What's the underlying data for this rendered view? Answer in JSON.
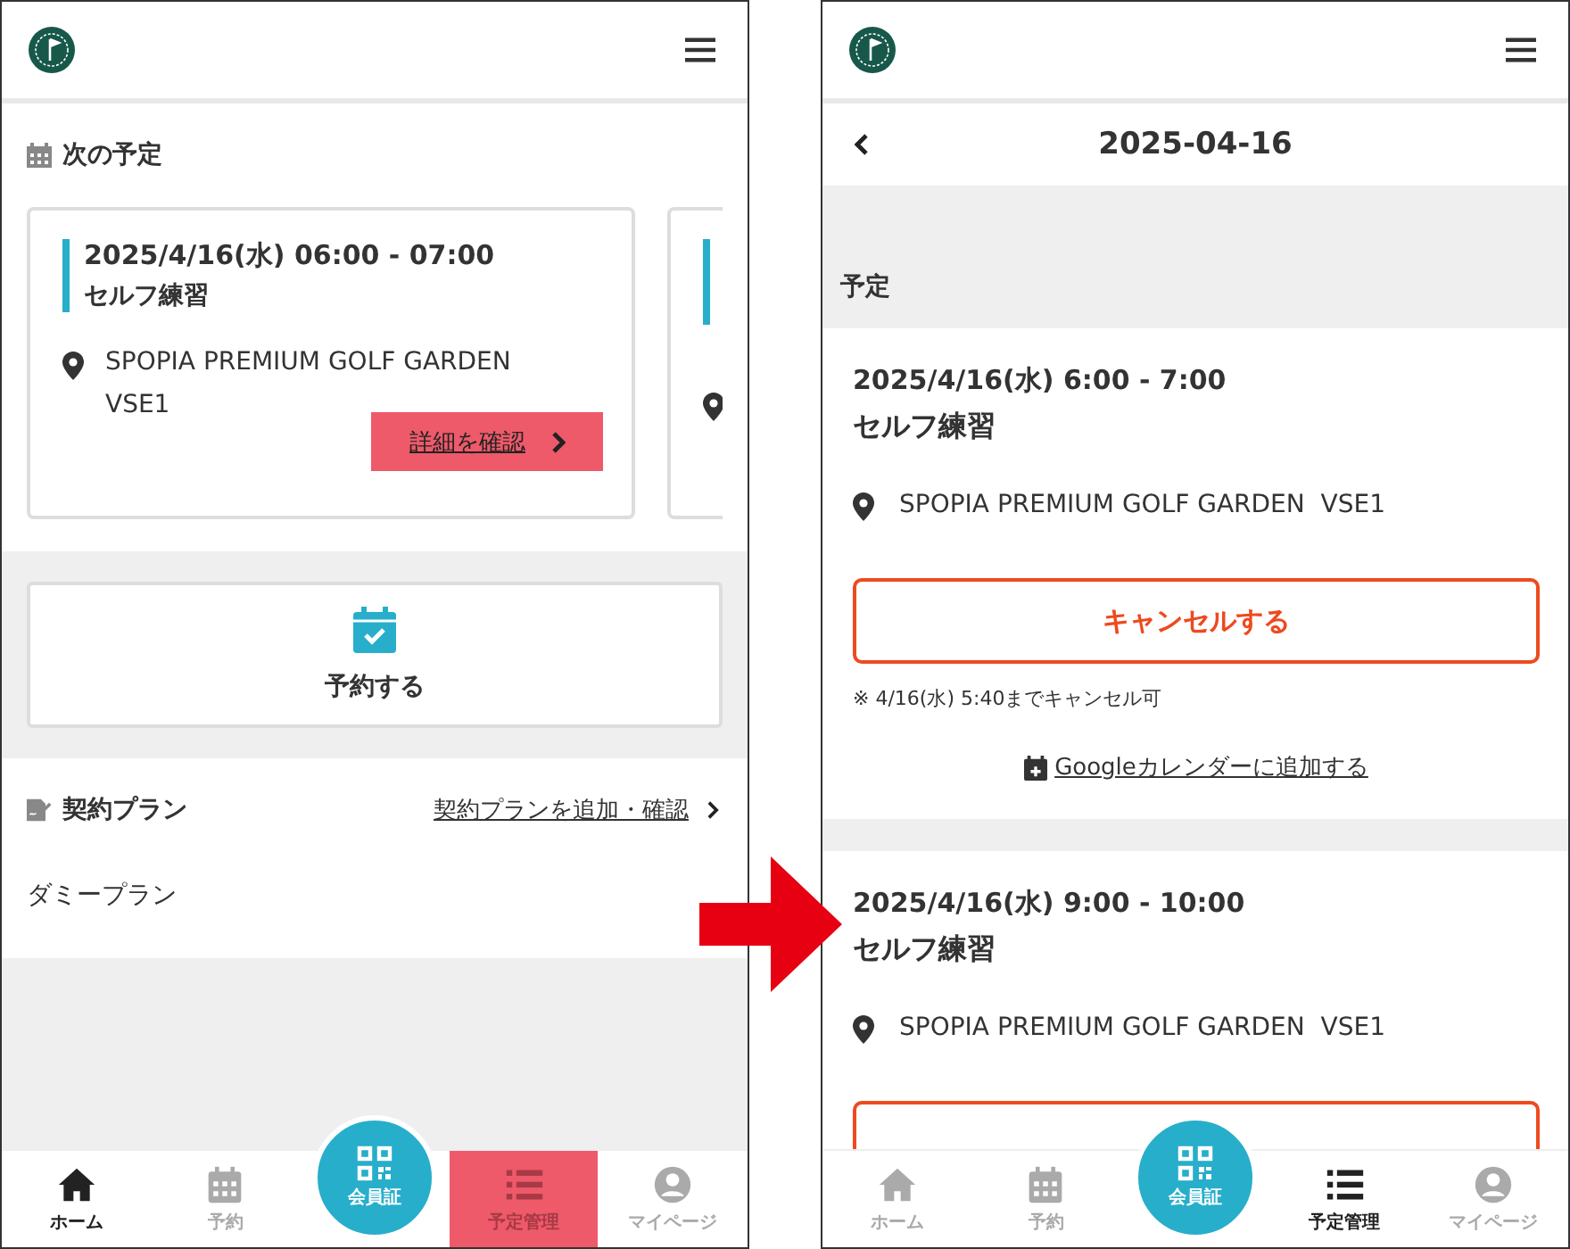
{
  "home_screen": {
    "next_title": "次の予定",
    "cards": [
      {
        "kind": "full",
        "datetime": "2025/4/16(水) 06:00 - 07:00",
        "title": "セルフ練習",
        "location": "SPOPIA PREMIUM GOLF GARDEN VSE1",
        "detail_button": "詳細を確認"
      },
      {
        "kind": "peek"
      }
    ],
    "reserve_button": "予約する",
    "plan_title": "契約プラン",
    "plan_link": "契約プランを追加・確認",
    "plans": [
      "ダミープラン"
    ],
    "nav": [
      {
        "kind": "tab",
        "label": "ホーム",
        "selected": true,
        "highlighted": false
      },
      {
        "kind": "tab",
        "label": "予約",
        "selected": false,
        "highlighted": false
      },
      {
        "kind": "center",
        "label": "会員証"
      },
      {
        "kind": "tab",
        "label": "予定管理",
        "selected": false,
        "highlighted": true
      },
      {
        "kind": "tab",
        "label": "マイページ",
        "selected": false,
        "highlighted": false
      }
    ]
  },
  "schedule_screen": {
    "date": "2025-04-16",
    "section_title": "予定",
    "events": [
      {
        "kind": "full",
        "datetime": "2025/4/16(水) 6:00 - 7:00",
        "title": "セルフ練習",
        "location": "SPOPIA PREMIUM GOLF GARDEN  VSE1",
        "cancel_button": "キャンセルする",
        "cancel_note": "※ 4/16(水) 5:40までキャンセル可",
        "calendar_link": "Googleカレンダーに追加する"
      },
      {
        "kind": "cut",
        "datetime": "2025/4/16(水) 9:00 - 10:00",
        "title": "セルフ練習",
        "location": "SPOPIA PREMIUM GOLF GARDEN  VSE1"
      }
    ],
    "nav": [
      {
        "kind": "tab",
        "label": "ホーム",
        "selected": false,
        "highlighted": false
      },
      {
        "kind": "tab",
        "label": "予約",
        "selected": false,
        "highlighted": false
      },
      {
        "kind": "center",
        "label": "会員証"
      },
      {
        "kind": "tab",
        "label": "予定管理",
        "selected": true,
        "highlighted": false
      },
      {
        "kind": "tab",
        "label": "マイページ",
        "selected": false,
        "highlighted": false
      }
    ]
  }
}
